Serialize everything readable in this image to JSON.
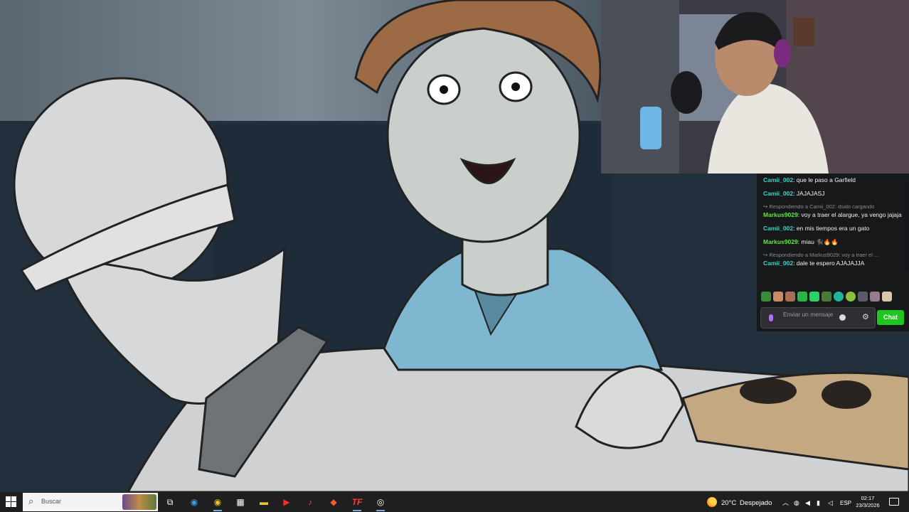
{
  "chat": {
    "messages": [
      {
        "user": "Camii_002",
        "color": "#3fd1c9",
        "text": "que le paso a Garfield"
      },
      {
        "user": "Camii_002",
        "color": "#3fd1c9",
        "text": "JAJAJASJ"
      },
      {
        "reply": "Respondiendo a Camii_002: dsalo cargando"
      },
      {
        "user": "Markus9029",
        "color": "#5dea3a",
        "text": "voy a traer el alargue, ya vengo jajaja"
      },
      {
        "user": "Camii_002",
        "color": "#3fd1c9",
        "text": "en mis tiempos era un gato"
      },
      {
        "user": "Markus9029",
        "color": "#5dea3a",
        "text": "miau 🐈‍⬛🔥🔥"
      },
      {
        "reply": "Respondiendo a Markus9029: voy a traer el ..."
      },
      {
        "user": "Camii_002",
        "color": "#3fd1c9",
        "text": "dale te espero AJAJAJJA"
      }
    ],
    "input_placeholder": "Enviar un mensaje",
    "send_button": "Chat",
    "accent": "#21c521"
  },
  "taskbar": {
    "search_placeholder": "Buscar",
    "weather_temp": "20°C",
    "weather_condition": "Despejado",
    "language": "ESP",
    "time": "02:17",
    "date": "23/3/2026"
  }
}
